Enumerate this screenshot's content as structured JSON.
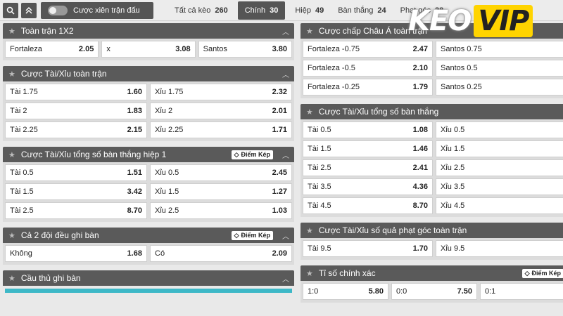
{
  "topbar": {
    "search_icon": "search-icon",
    "collapse_icon": "double-chevron-up-icon",
    "toggle_label": "Cược xiên trận đấu",
    "tabs": [
      {
        "label": "Tất cả kèo",
        "count": "260"
      },
      {
        "label": "Chính",
        "count": "30"
      },
      {
        "label": "Hiệp",
        "count": "49"
      },
      {
        "label": "Bàn thắng",
        "count": "24"
      },
      {
        "label": "Phạt góc",
        "count": "28"
      }
    ]
  },
  "logo": {
    "part1": "KEO",
    "part2": "VIP"
  },
  "left": {
    "p1": {
      "title": "Toàn trận 1X2",
      "rows": [
        [
          [
            "Fortaleza",
            "2.05"
          ],
          [
            "x",
            "3.08"
          ],
          [
            "Santos",
            "3.80"
          ]
        ]
      ]
    },
    "p2": {
      "title": "Cược Tài/Xỉu toàn trận",
      "rows": [
        [
          [
            "Tài 1.75",
            "1.60"
          ],
          [
            "Xỉu 1.75",
            "2.32"
          ]
        ],
        [
          [
            "Tài 2",
            "1.83"
          ],
          [
            "Xỉu 2",
            "2.01"
          ]
        ],
        [
          [
            "Tài 2.25",
            "2.15"
          ],
          [
            "Xỉu 2.25",
            "1.71"
          ]
        ]
      ]
    },
    "p3": {
      "title": "Cược Tài/Xỉu tổng số bàn thắng hiệp 1",
      "badge": "Điểm Kép",
      "rows": [
        [
          [
            "Tài 0.5",
            "1.51"
          ],
          [
            "Xỉu 0.5",
            "2.45"
          ]
        ],
        [
          [
            "Tài 1.5",
            "3.42"
          ],
          [
            "Xỉu 1.5",
            "1.27"
          ]
        ],
        [
          [
            "Tài 2.5",
            "8.70"
          ],
          [
            "Xỉu 2.5",
            "1.03"
          ]
        ]
      ]
    },
    "p4": {
      "title": "Cả 2 đội đều ghi bàn",
      "badge": "Điểm Kép",
      "rows": [
        [
          [
            "Không",
            "1.68"
          ],
          [
            "Có",
            "2.09"
          ]
        ]
      ]
    },
    "p5": {
      "title": "Cầu thủ ghi bàn"
    }
  },
  "right": {
    "p1": {
      "title": "Cược chấp Châu Á toàn trận",
      "rows": [
        [
          [
            "Fortaleza -0.75",
            "2.47"
          ],
          [
            "Santos 0.75",
            ""
          ]
        ],
        [
          [
            "Fortaleza -0.5",
            "2.10"
          ],
          [
            "Santos 0.5",
            ""
          ]
        ],
        [
          [
            "Fortaleza -0.25",
            "1.79"
          ],
          [
            "Santos 0.25",
            ""
          ]
        ]
      ]
    },
    "p2": {
      "title": "Cược Tài/Xỉu tổng số bàn thắng",
      "rows": [
        [
          [
            "Tài 0.5",
            "1.08"
          ],
          [
            "Xỉu 0.5",
            ""
          ]
        ],
        [
          [
            "Tài 1.5",
            "1.46"
          ],
          [
            "Xỉu 1.5",
            ""
          ]
        ],
        [
          [
            "Tài 2.5",
            "2.41"
          ],
          [
            "Xỉu 2.5",
            ""
          ]
        ],
        [
          [
            "Tài 3.5",
            "4.36"
          ],
          [
            "Xỉu 3.5",
            ""
          ]
        ],
        [
          [
            "Tài 4.5",
            "8.70"
          ],
          [
            "Xỉu 4.5",
            ""
          ]
        ]
      ]
    },
    "p3": {
      "title": "Cược Tài/Xỉu số quả phạt góc toàn trận",
      "rows": [
        [
          [
            "Tài 9.5",
            "1.70"
          ],
          [
            "Xỉu 9.5",
            ""
          ]
        ]
      ]
    },
    "p4": {
      "title": "Tỉ số chính xác",
      "badge": "Điểm Kép",
      "rows": [
        [
          [
            "1:0",
            "5.80"
          ],
          [
            "0:0",
            "7.50"
          ],
          [
            "0:1",
            ""
          ]
        ]
      ]
    }
  }
}
